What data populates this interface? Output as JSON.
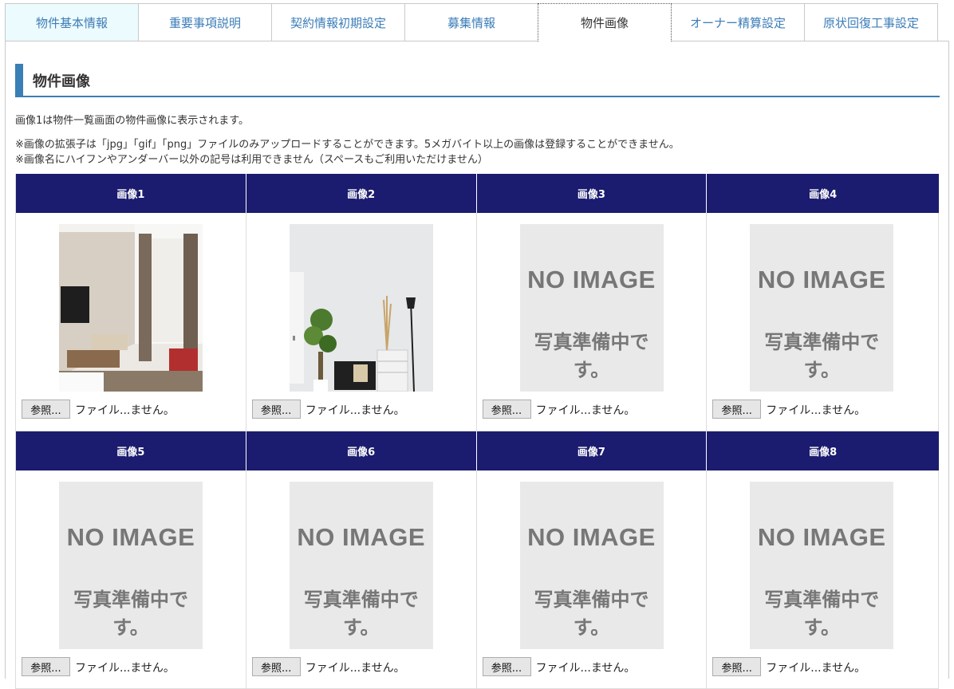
{
  "tabs": [
    {
      "label": "物件基本情報"
    },
    {
      "label": "重要事項説明"
    },
    {
      "label": "契約情報初期設定"
    },
    {
      "label": "募集情報"
    },
    {
      "label": "物件画像"
    },
    {
      "label": "オーナー精算設定"
    },
    {
      "label": "原状回復工事設定"
    }
  ],
  "section": {
    "title": "物件画像",
    "desc1": "画像1は物件一覧画面の物件画像に表示されます。",
    "desc2": "※画像の拡張子は「jpg」「gif」「png」ファイルのみアップロードすることができます。5メガバイト以上の画像は登録することができません。",
    "desc3": "※画像名にハイフンやアンダーバー以外の記号は利用できません（スペースもご利用いただけません）"
  },
  "images": [
    {
      "header": "画像1",
      "browse": "参照...",
      "file": "ファイル...ません。"
    },
    {
      "header": "画像2",
      "browse": "参照...",
      "file": "ファイル...ません。"
    },
    {
      "header": "画像3",
      "browse": "参照...",
      "file": "ファイル...ません。",
      "noimage_en": "NO IMAGE",
      "noimage_ja": "写真準備中です。"
    },
    {
      "header": "画像4",
      "browse": "参照...",
      "file": "ファイル...ません。",
      "noimage_en": "NO IMAGE",
      "noimage_ja": "写真準備中です。"
    },
    {
      "header": "画像5",
      "browse": "参照...",
      "file": "ファイル...ません。",
      "noimage_en": "NO IMAGE",
      "noimage_ja": "写真準備中です。"
    },
    {
      "header": "画像6",
      "browse": "参照...",
      "file": "ファイル...ません。",
      "noimage_en": "NO IMAGE",
      "noimage_ja": "写真準備中です。"
    },
    {
      "header": "画像7",
      "browse": "参照...",
      "file": "ファイル...ません。",
      "noimage_en": "NO IMAGE",
      "noimage_ja": "写真準備中です。"
    },
    {
      "header": "画像8",
      "browse": "参照...",
      "file": "ファイル...ません。",
      "noimage_en": "NO IMAGE",
      "noimage_ja": "写真準備中です。"
    }
  ],
  "colors": {
    "header_bg": "#1b1b6f",
    "accent": "#3a7fb6",
    "tab_text": "#3a7cb8"
  }
}
